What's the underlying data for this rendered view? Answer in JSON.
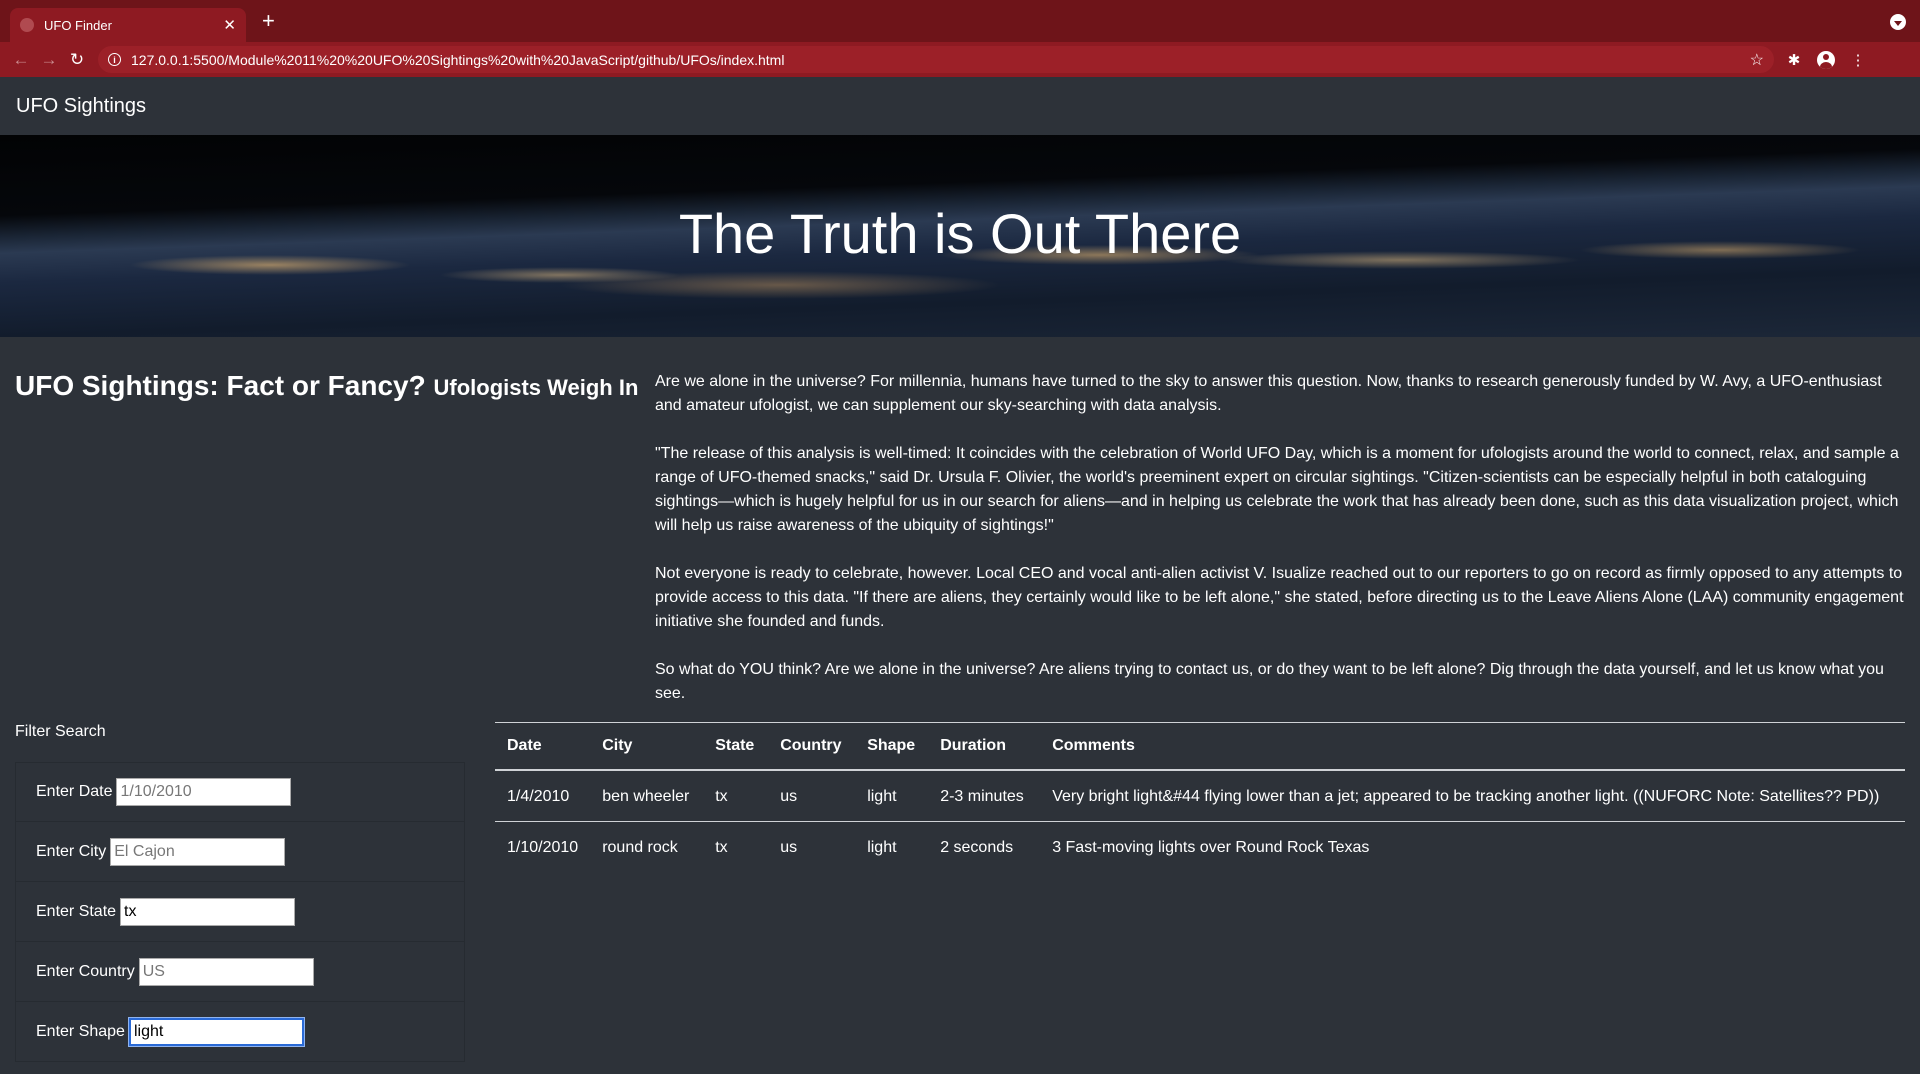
{
  "browser": {
    "tab_title": "UFO Finder",
    "url": "127.0.0.1:5500/Module%2011%20%20UFO%20Sightings%20with%20JavaScript/github/UFOs/index.html"
  },
  "navbar": {
    "brand": "UFO Sightings"
  },
  "hero": {
    "title": "The Truth is Out There"
  },
  "heading": {
    "main": "UFO Sightings: Fact or Fancy?",
    "sub": "Ufologists Weigh In"
  },
  "article": {
    "paragraphs": [
      "Are we alone in the universe? For millennia, humans have turned to the sky to answer this question. Now, thanks to research generously funded by W. Avy, a UFO-enthusiast and amateur ufologist, we can supplement our sky-searching with data analysis.",
      "\"The release of this analysis is well-timed: It coincides with the celebration of World UFO Day, which is a moment for ufologists around the world to connect, relax, and sample a range of UFO-themed snacks,\" said Dr. Ursula F. Olivier, the world's preeminent expert on circular sightings. \"Citizen-scientists can be especially helpful in both cataloguing sightings—which is hugely helpful for us in our search for aliens—and in helping us celebrate the work that has already been done, such as this data visualization project, which will help us raise awareness of the ubiquity of sightings!\"",
      "Not everyone is ready to celebrate, however. Local CEO and vocal anti-alien activist V. Isualize reached out to our reporters to go on record as firmly opposed to any attempts to provide access to this data. \"If there are aliens, they certainly would like to be left alone,\" she stated, before directing us to the Leave Aliens Alone (LAA) community engagement initiative she founded and funds.",
      "So what do YOU think? Are we alone in the universe? Are aliens trying to contact us, or do they want to be left alone? Dig through the data yourself, and let us know what you see."
    ]
  },
  "filters": {
    "title": "Filter Search",
    "date": {
      "label": "Enter Date",
      "placeholder": "1/10/2010",
      "value": ""
    },
    "city": {
      "label": "Enter City",
      "placeholder": "El Cajon",
      "value": ""
    },
    "state": {
      "label": "Enter State",
      "placeholder": "",
      "value": "tx"
    },
    "country": {
      "label": "Enter Country",
      "placeholder": "US",
      "value": ""
    },
    "shape": {
      "label": "Enter Shape",
      "placeholder": "",
      "value": "light"
    }
  },
  "table": {
    "headers": [
      "Date",
      "City",
      "State",
      "Country",
      "Shape",
      "Duration",
      "Comments"
    ],
    "rows": [
      [
        "1/4/2010",
        "ben wheeler",
        "tx",
        "us",
        "light",
        "2-3 minutes",
        "Very bright light&#44 flying lower than a jet; appeared to be tracking another light. ((NUFORC Note: Satellites?? PD))"
      ],
      [
        "1/10/2010",
        "round rock",
        "tx",
        "us",
        "light",
        "2 seconds",
        "3 Fast-moving lights over Round Rock Texas"
      ]
    ]
  }
}
